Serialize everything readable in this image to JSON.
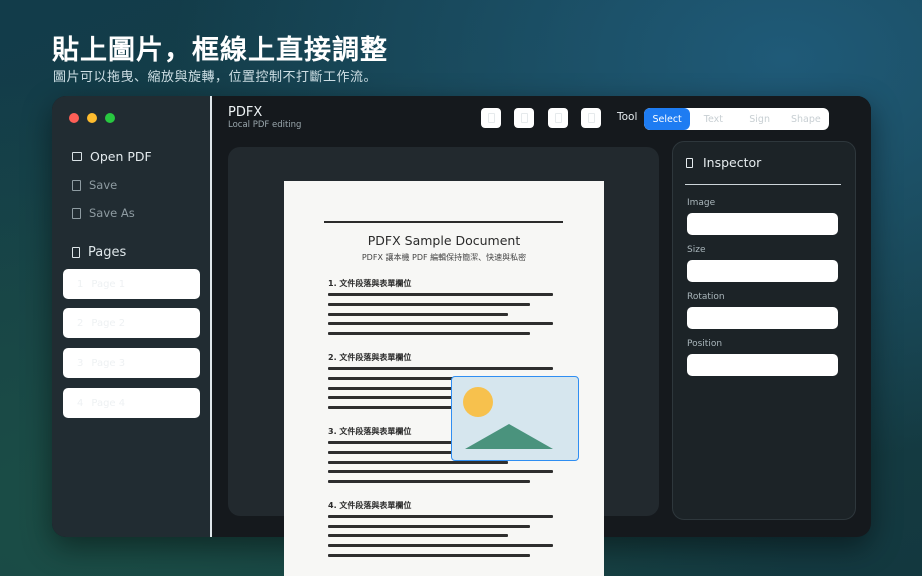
{
  "headline": "貼上圖片，框線上直接調整",
  "subline": "圖片可以拖曳、縮放與旋轉，位置控制不打斷工作流。",
  "app": {
    "title": "PDFX",
    "subtitle": "Local PDF editing"
  },
  "sidebar": {
    "open_label": "Open PDF",
    "save_label": "Save",
    "save_as_label": "Save As",
    "pages_label": "Pages",
    "pages": [
      {
        "label": "Page 1"
      },
      {
        "label": "Page 2"
      },
      {
        "label": "Page 3"
      },
      {
        "label": "Page 4"
      }
    ]
  },
  "toolbar": {
    "tool_label": "Tool",
    "modes": [
      "Select",
      "Text",
      "Sign",
      "Shape"
    ],
    "active_mode": "Select"
  },
  "inspector": {
    "title": "Inspector",
    "fields": [
      {
        "label": "Image"
      },
      {
        "label": "Size"
      },
      {
        "label": "Rotation"
      },
      {
        "label": "Position"
      }
    ]
  },
  "document": {
    "title": "PDFX Sample Document",
    "subtitle": "PDFX 讓本機 PDF 編輯保持簡潔、快速與私密",
    "sections": [
      "1. 文件段落與表單欄位",
      "2. 文件段落與表單欄位",
      "3. 文件段落與表單欄位",
      "4. 文件段落與表單欄位"
    ]
  },
  "colors": {
    "accent": "#1e7cf2",
    "sidebar": "#212c32",
    "window": "#15191d",
    "image_sky": "#d6e6ee",
    "image_sun": "#f7c14d",
    "image_mountain": "#4a937d"
  }
}
